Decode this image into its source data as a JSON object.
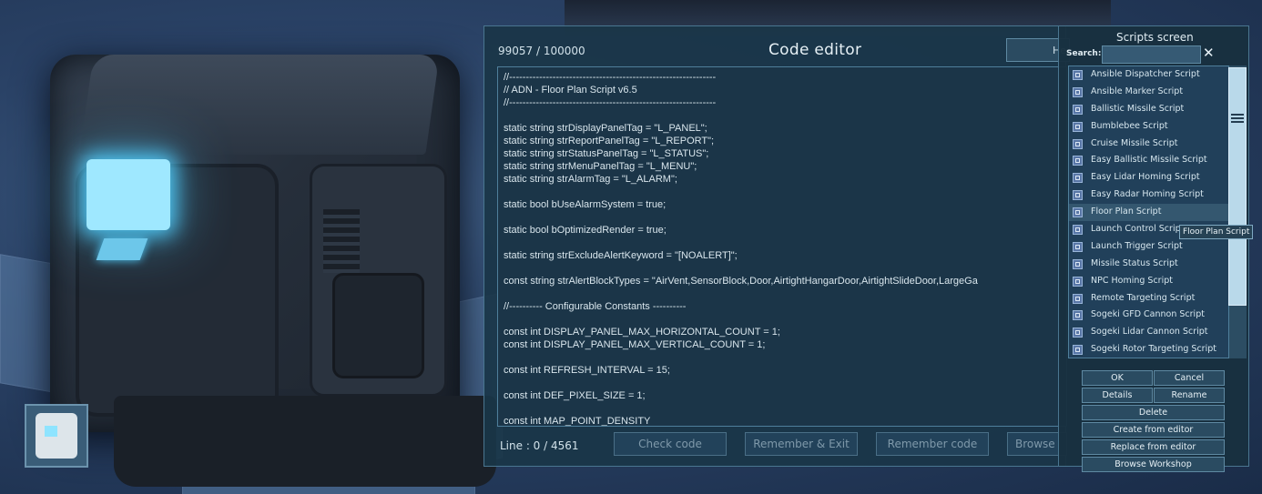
{
  "editor": {
    "char_count": "99057 / 100000",
    "title": "Code editor",
    "help_label": "He",
    "line_info": "Line : 0 / 4561",
    "buttons": {
      "check": "Check code",
      "remember_exit": "Remember & Exit",
      "remember": "Remember code",
      "browse": "Browse"
    },
    "code_lines": [
      "//--------------------------------------------------------------",
      "// ADN - Floor Plan Script v6.5",
      "//--------------------------------------------------------------",
      "",
      "static string strDisplayPanelTag = \"L_PANEL\";",
      "static string strReportPanelTag = \"L_REPORT\";",
      "static string strStatusPanelTag = \"L_STATUS\";",
      "static string strMenuPanelTag = \"L_MENU\";",
      "static string strAlarmTag = \"L_ALARM\";",
      "",
      "static bool bUseAlarmSystem = true;",
      "",
      "static bool bOptimizedRender = true;",
      "",
      "static string strExcludeAlertKeyword = \"[NOALERT]\";",
      "",
      "const string strAlertBlockTypes = \"AirVent,SensorBlock,Door,AirtightHangarDoor,AirtightSlideDoor,LargeGa",
      "",
      "//---------- Configurable Constants ----------",
      "",
      "const int DISPLAY_PANEL_MAX_HORIZONTAL_COUNT = 1;",
      "const int DISPLAY_PANEL_MAX_VERTICAL_COUNT = 1;",
      "",
      "const int REFRESH_INTERVAL = 15;",
      "",
      "const int DEF_PIXEL_SIZE = 1;",
      "",
      "const int MAP_POINT_DENSITY"
    ]
  },
  "scripts": {
    "title": "Scripts screen",
    "search_label": "Search:",
    "search_value": "",
    "clear_glyph": "✕",
    "items": [
      "Ansible Dispatcher Script",
      "Ansible Marker Script",
      "Ballistic Missile Script",
      "Bumblebee Script",
      "Cruise Missile Script",
      "Easy Ballistic Missile Script",
      "Easy Lidar Homing Script",
      "Easy Radar Homing Script",
      "Floor Plan Script",
      "Launch Control Script",
      "Launch Trigger Script",
      "Missile Status Script",
      "NPC Homing Script",
      "Remote Targeting Script",
      "Sogeki GFD Cannon Script",
      "Sogeki Lidar Cannon Script",
      "Sogeki Rotor Targeting Script"
    ],
    "selected_item": "Floor Plan Script",
    "tooltip": "Floor Plan Script",
    "buttons": {
      "ok": "OK",
      "cancel": "Cancel",
      "details": "Details",
      "rename": "Rename",
      "delete": "Delete",
      "create": "Create from editor",
      "replace": "Replace from editor",
      "browse_workshop": "Browse Workshop"
    }
  },
  "icons": {
    "block_icon": "programmable-block-icon",
    "script_icon": "script-file-icon"
  },
  "colors": {
    "panel_bg": "#1a3648",
    "border": "#4a7690",
    "screen_glow": "#4fc6f3"
  }
}
